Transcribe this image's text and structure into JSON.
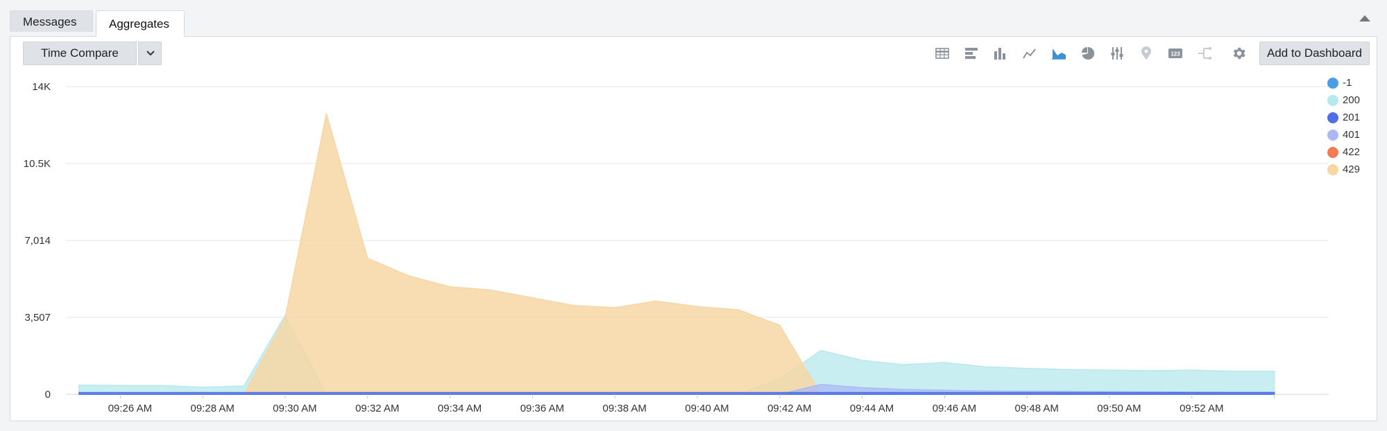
{
  "tabs": [
    {
      "label": "Messages"
    },
    {
      "label": "Aggregates"
    }
  ],
  "toolbar": {
    "time_compare_label": "Time Compare",
    "add_to_dashboard_label": "Add to Dashboard",
    "icons": [
      "table-icon",
      "bar-chart-icon",
      "column-chart-icon",
      "line-chart-icon",
      "area-chart-icon",
      "pie-chart-icon",
      "box-plot-icon",
      "map-icon",
      "single-value-icon",
      "sankey-icon",
      "gear-icon"
    ],
    "active_icon": "area-chart-icon",
    "colors": {
      "active": "#3d8fd8",
      "normal": "#8a929b",
      "disabled": "#c6cbd0"
    }
  },
  "chart_data": {
    "type": "area",
    "ylim": [
      0,
      14028
    ],
    "yticks": [
      0,
      3507,
      7014,
      10521,
      14028
    ],
    "ytick_labels": [
      "0",
      "3,507",
      "7,014",
      "10.5K",
      "14K"
    ],
    "x_categories": [
      "09:25",
      "09:26",
      "09:27",
      "09:28",
      "09:29",
      "09:30",
      "09:31",
      "09:32",
      "09:33",
      "09:34",
      "09:35",
      "09:36",
      "09:37",
      "09:38",
      "09:39",
      "09:40",
      "09:41",
      "09:42",
      "09:43",
      "09:44",
      "09:45",
      "09:46",
      "09:47",
      "09:48",
      "09:49",
      "09:50",
      "09:51",
      "09:52",
      "09:53",
      "09:54"
    ],
    "xtick_labels": [
      "09:26 AM",
      "09:28 AM",
      "09:30 AM",
      "09:32 AM",
      "09:34 AM",
      "09:36 AM",
      "09:38 AM",
      "09:40 AM",
      "09:42 AM",
      "09:44 AM",
      "09:46 AM",
      "09:48 AM",
      "09:50 AM",
      "09:52 AM"
    ],
    "grid": true,
    "legend_position": "top-right",
    "series": [
      {
        "name": "-1",
        "color": "#4a9fe3",
        "values": [
          0,
          0,
          0,
          0,
          0,
          0,
          0,
          0,
          0,
          0,
          0,
          0,
          0,
          0,
          0,
          0,
          0,
          0,
          0,
          0,
          0,
          0,
          0,
          0,
          0,
          0,
          0,
          0,
          0,
          0
        ]
      },
      {
        "name": "200",
        "color": "#b7e8ee",
        "values": [
          420,
          400,
          400,
          320,
          380,
          3600,
          0,
          0,
          0,
          0,
          0,
          0,
          0,
          0,
          0,
          0,
          0,
          700,
          2000,
          1550,
          1350,
          1450,
          1250,
          1180,
          1130,
          1100,
          1080,
          1100,
          1050,
          1050
        ]
      },
      {
        "name": "201",
        "color": "#4f6fe6",
        "values": [
          80,
          80,
          80,
          80,
          80,
          80,
          80,
          80,
          80,
          80,
          80,
          80,
          80,
          80,
          80,
          80,
          80,
          80,
          80,
          80,
          80,
          80,
          80,
          80,
          80,
          80,
          80,
          80,
          80,
          80
        ]
      },
      {
        "name": "401",
        "color": "#aab9f5",
        "values": [
          0,
          0,
          0,
          0,
          0,
          0,
          0,
          0,
          0,
          0,
          0,
          0,
          0,
          0,
          0,
          0,
          0,
          0,
          450,
          300,
          220,
          180,
          150,
          140,
          130,
          120,
          110,
          100,
          90,
          90
        ]
      },
      {
        "name": "422",
        "color": "#f27b4f",
        "values": [
          0,
          0,
          0,
          0,
          0,
          0,
          0,
          0,
          0,
          0,
          0,
          0,
          0,
          0,
          0,
          0,
          0,
          0,
          0,
          0,
          0,
          0,
          0,
          0,
          0,
          0,
          0,
          0,
          0,
          0
        ]
      },
      {
        "name": "429",
        "color": "#f7d6a4",
        "values": [
          0,
          0,
          0,
          0,
          0,
          3500,
          12800,
          6200,
          5400,
          4900,
          4750,
          4400,
          4050,
          3950,
          4250,
          4000,
          3850,
          3150,
          0,
          0,
          0,
          0,
          0,
          0,
          0,
          0,
          0,
          0,
          0,
          0
        ]
      }
    ]
  }
}
